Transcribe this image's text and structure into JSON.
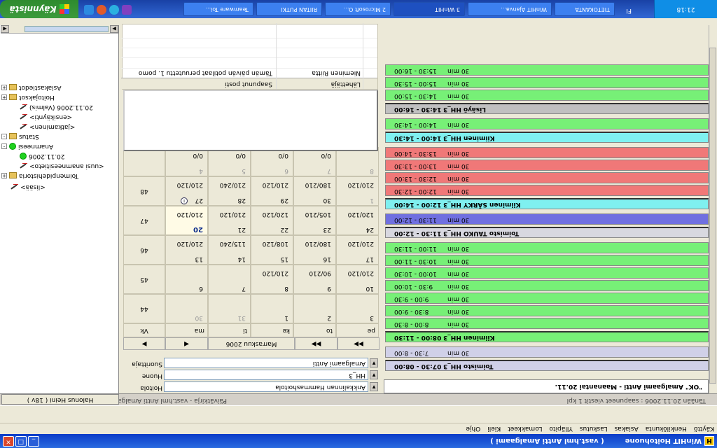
{
  "window": {
    "app_icon": "H",
    "title": "WinHIT Hoitohuone",
    "user": "( vast.hml Antti Amalgaami )",
    "minimize_icon": "minimize-icon",
    "maximize_icon": "maximize-icon",
    "close_icon": "close-icon"
  },
  "menu": [
    "Käyttö",
    "Henkilökunta",
    "Asiakas",
    "Laskutus",
    "Ylläpito",
    "Lomakkeet",
    "Kieli",
    "Ohje"
  ],
  "status": {
    "patient": "Halonus Heini ( 18v )",
    "left": "Tänään 20.11.2006 : saapuneet viestit 1 kpl",
    "mid": "Päivätkirja - vast.hml Antti Amalgaami"
  },
  "tree": [
    {
      "label": "Asiakastiedot",
      "icon": "folder",
      "exp": "+",
      "level": 0
    },
    {
      "label": "Hoitojaksot",
      "icon": "folder",
      "exp": "+",
      "level": 0
    },
    {
      "label": "20.11.2006 (Valmis)",
      "icon": "document",
      "exp": "",
      "level": 2
    },
    {
      "label": "<ensikäynti>",
      "icon": "pen",
      "exp": "",
      "level": 2
    },
    {
      "label": "<jatkaminen>",
      "icon": "pen",
      "exp": "",
      "level": 2
    },
    {
      "label": "Status",
      "icon": "folder",
      "exp": "-",
      "level": 0
    },
    {
      "label": "Anamneesi",
      "icon": "green",
      "exp": "-",
      "level": 0
    },
    {
      "label": "20.11.2006",
      "icon": "green",
      "exp": "",
      "level": 2
    },
    {
      "label": "<uusi anamneesitieto>",
      "icon": "pen",
      "exp": "",
      "level": 2
    },
    {
      "label": "Toimenpidehistoria",
      "icon": "folder",
      "exp": "+",
      "level": 0
    },
    {
      "label": "<lisää>",
      "icon": "pen",
      "exp": "",
      "level": 1
    }
  ],
  "fields": {
    "hoitola_label": "Hoitola",
    "hoitola_value": "Ankkalinnan Hammashoitola",
    "huone_label": "Huone",
    "huone_value": "HH_3",
    "suorittaja_label": "Suorittaja",
    "suorittaja_value": "Amalgaami Antti"
  },
  "calendar": {
    "nav": {
      "first": "◀◀",
      "prev": "◀◀",
      "month": "Marraskuu 2006",
      "next": "▶",
      "last": "◀"
    },
    "dow": [
      "ma",
      "ti",
      "ke",
      "to",
      "pe"
    ],
    "week_header": "Vk",
    "weeks": [
      {
        "wk": "44",
        "days": [
          {
            "n": "30",
            "v": "",
            "dim": true
          },
          {
            "n": "31",
            "v": "",
            "dim": true
          },
          {
            "n": "1",
            "v": ""
          },
          {
            "n": "2",
            "v": ""
          },
          {
            "n": "3",
            "v": ""
          }
        ]
      },
      {
        "wk": "45",
        "days": [
          {
            "n": "6",
            "v": ""
          },
          {
            "n": "7",
            "v": ""
          },
          {
            "n": "8",
            "v": "210/120"
          },
          {
            "n": "9",
            "v": "90/210"
          },
          {
            "n": "10",
            "v": "210/120"
          }
        ]
      },
      {
        "wk": "46",
        "days": [
          {
            "n": "13",
            "v": "210/120"
          },
          {
            "n": "14",
            "v": "115/240"
          },
          {
            "n": "15",
            "v": "108/120"
          },
          {
            "n": "16",
            "v": "180/210"
          },
          {
            "n": "17",
            "v": "210/120"
          }
        ]
      },
      {
        "wk": "47",
        "days": [
          {
            "n": "20",
            "v": "210/120",
            "bold": true,
            "sel": true
          },
          {
            "n": "21",
            "v": "210/120"
          },
          {
            "n": "22",
            "v": "120/120"
          },
          {
            "n": "23",
            "v": "105/210"
          },
          {
            "n": "24",
            "v": "120/120"
          }
        ]
      },
      {
        "wk": "48",
        "days": [
          {
            "n": "27",
            "v": "210/120",
            "info": true
          },
          {
            "n": "28",
            "v": "210/240"
          },
          {
            "n": "29",
            "v": "210/120"
          },
          {
            "n": "30",
            "v": "180/210"
          },
          {
            "n": "1",
            "v": "210/120",
            "dim": true
          }
        ]
      },
      {
        "wk": "",
        "days": [
          {
            "n": "4",
            "v": "0/0",
            "dim": true
          },
          {
            "n": "5",
            "v": "0/0",
            "dim": true
          },
          {
            "n": "6",
            "v": "0/0",
            "dim": true
          },
          {
            "n": "7",
            "v": "0/0",
            "dim": true
          },
          {
            "n": "8",
            "v": "",
            "dim": true
          }
        ]
      }
    ]
  },
  "messages": {
    "col1": "Saapunut posti",
    "col2": "Lähettäjä",
    "row_text": "Tämän päivän potilaat peruutettu 1. pomo",
    "row_sender": "Nieminen Riitta"
  },
  "schedule": {
    "footer": "\"OK\" Amalgaami Antti - Maanantai 20.11.",
    "slots": [
      {
        "t": "07:30 - 08:00",
        "d": "Toimisto HH_3",
        "type": "head",
        "color": "#d0d0e8"
      },
      {
        "t": "7:30 - 8:00",
        "d": "30 min",
        "type": "slot",
        "color": "#d0d0e8"
      },
      {
        "t": "08:00 - 11:30",
        "d": "Kiiminen HH_3",
        "type": "head",
        "color": "#77f077"
      },
      {
        "t": "8:00 - 8:30",
        "d": "30 min",
        "type": "slot",
        "color": "#77f077"
      },
      {
        "t": "8:30 - 9:00",
        "d": "30 min",
        "type": "slot",
        "color": "#77f077"
      },
      {
        "t": "9:00 - 9:30",
        "d": "30 min",
        "type": "slot",
        "color": "#77f077"
      },
      {
        "t": "9:30 - 10:00",
        "d": "30 min",
        "type": "slot",
        "color": "#77f077"
      },
      {
        "t": "10:00 - 10:30",
        "d": "30 min",
        "type": "slot",
        "color": "#77f077"
      },
      {
        "t": "10:30 - 11:00",
        "d": "30 min",
        "type": "slot",
        "color": "#77f077"
      },
      {
        "t": "11:00 - 11:30",
        "d": "30 min",
        "type": "slot",
        "color": "#77f077"
      },
      {
        "t": "11:30 - 12:00",
        "d": "Toimisto TAUKO HH_3",
        "type": "head",
        "color": "#d8d8e0"
      },
      {
        "t": "11:30 - 12:00",
        "d": "30 min",
        "type": "slot",
        "color": "#7070e0"
      },
      {
        "t": "12:00 - 14:00",
        "d": "Kiiminen SÄRKY HH_3",
        "type": "head",
        "color": "#7ff0f0"
      },
      {
        "t": "12:00 - 12:30",
        "d": "30 min",
        "type": "slot",
        "color": "#f07878"
      },
      {
        "t": "12:30 - 13:00",
        "d": "30 min",
        "type": "slot",
        "color": "#f07878"
      },
      {
        "t": "13:00 - 13:30",
        "d": "30 min",
        "type": "slot",
        "color": "#f07878"
      },
      {
        "t": "13:30 - 14:00",
        "d": "30 min",
        "type": "slot",
        "color": "#f07878"
      },
      {
        "t": "14:00 - 14:30",
        "d": "Kiiminen HH_3",
        "type": "head",
        "color": "#7ff0f0"
      },
      {
        "t": "14:00 - 14:30",
        "d": "30 min",
        "type": "slot",
        "color": "#77f077"
      },
      {
        "t": "14:30 - 16:00",
        "d": "Lisäyö HH_3",
        "type": "head",
        "color": "#c0c0c0"
      },
      {
        "t": "14:30 - 15:00",
        "d": "30 min",
        "type": "slot",
        "color": "#77f077"
      },
      {
        "t": "15:00 - 15:30",
        "d": "30 min",
        "type": "slot",
        "color": "#77f077"
      },
      {
        "t": "15:30 - 16:00",
        "d": "30 min",
        "type": "slot",
        "color": "#77f077"
      }
    ]
  },
  "taskbar": {
    "start": "Käynnistä",
    "buttons": [
      "Teamware Toi...",
      "RIITAN PUTKI",
      "2 Microsoft O...",
      "3 WinHIT",
      "WinHIT Ajanva...",
      "TIETOKANTA"
    ],
    "lang": "FI",
    "clock": "21:18"
  }
}
